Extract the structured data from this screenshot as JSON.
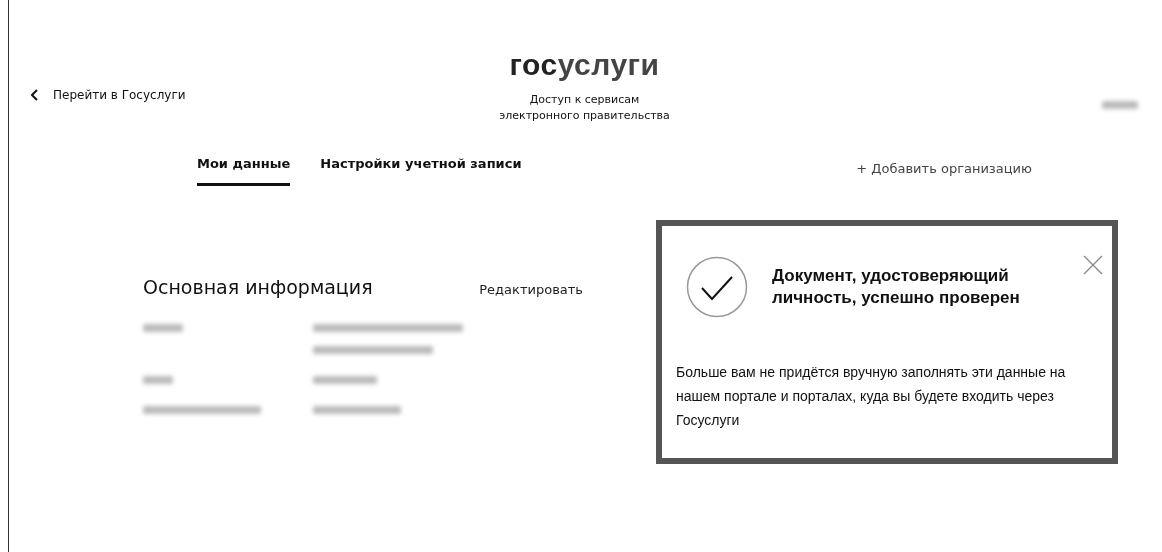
{
  "header": {
    "back_link": "Перейти в Госуслуги",
    "logo": {
      "dark_part": "гос",
      "light_part": "услуги"
    },
    "subtitle_lines": [
      "Доступ к сервисам",
      "электронного правительства"
    ]
  },
  "tabs": [
    {
      "label": "Мои данные",
      "selected": true
    },
    {
      "label": "Настройки учетной записи",
      "selected": false
    }
  ],
  "add_organization": "+ Добавить организацию",
  "section": {
    "title": "Основная информация",
    "edit_link": "Редактировать"
  },
  "notification": {
    "title": "Документ, удостоверяющий личность, успешно проверен",
    "body": "Больше вам не придётся вручную заполнять эти данные на нашем портале и порталах, куда вы будете входить через Госуслуги"
  }
}
